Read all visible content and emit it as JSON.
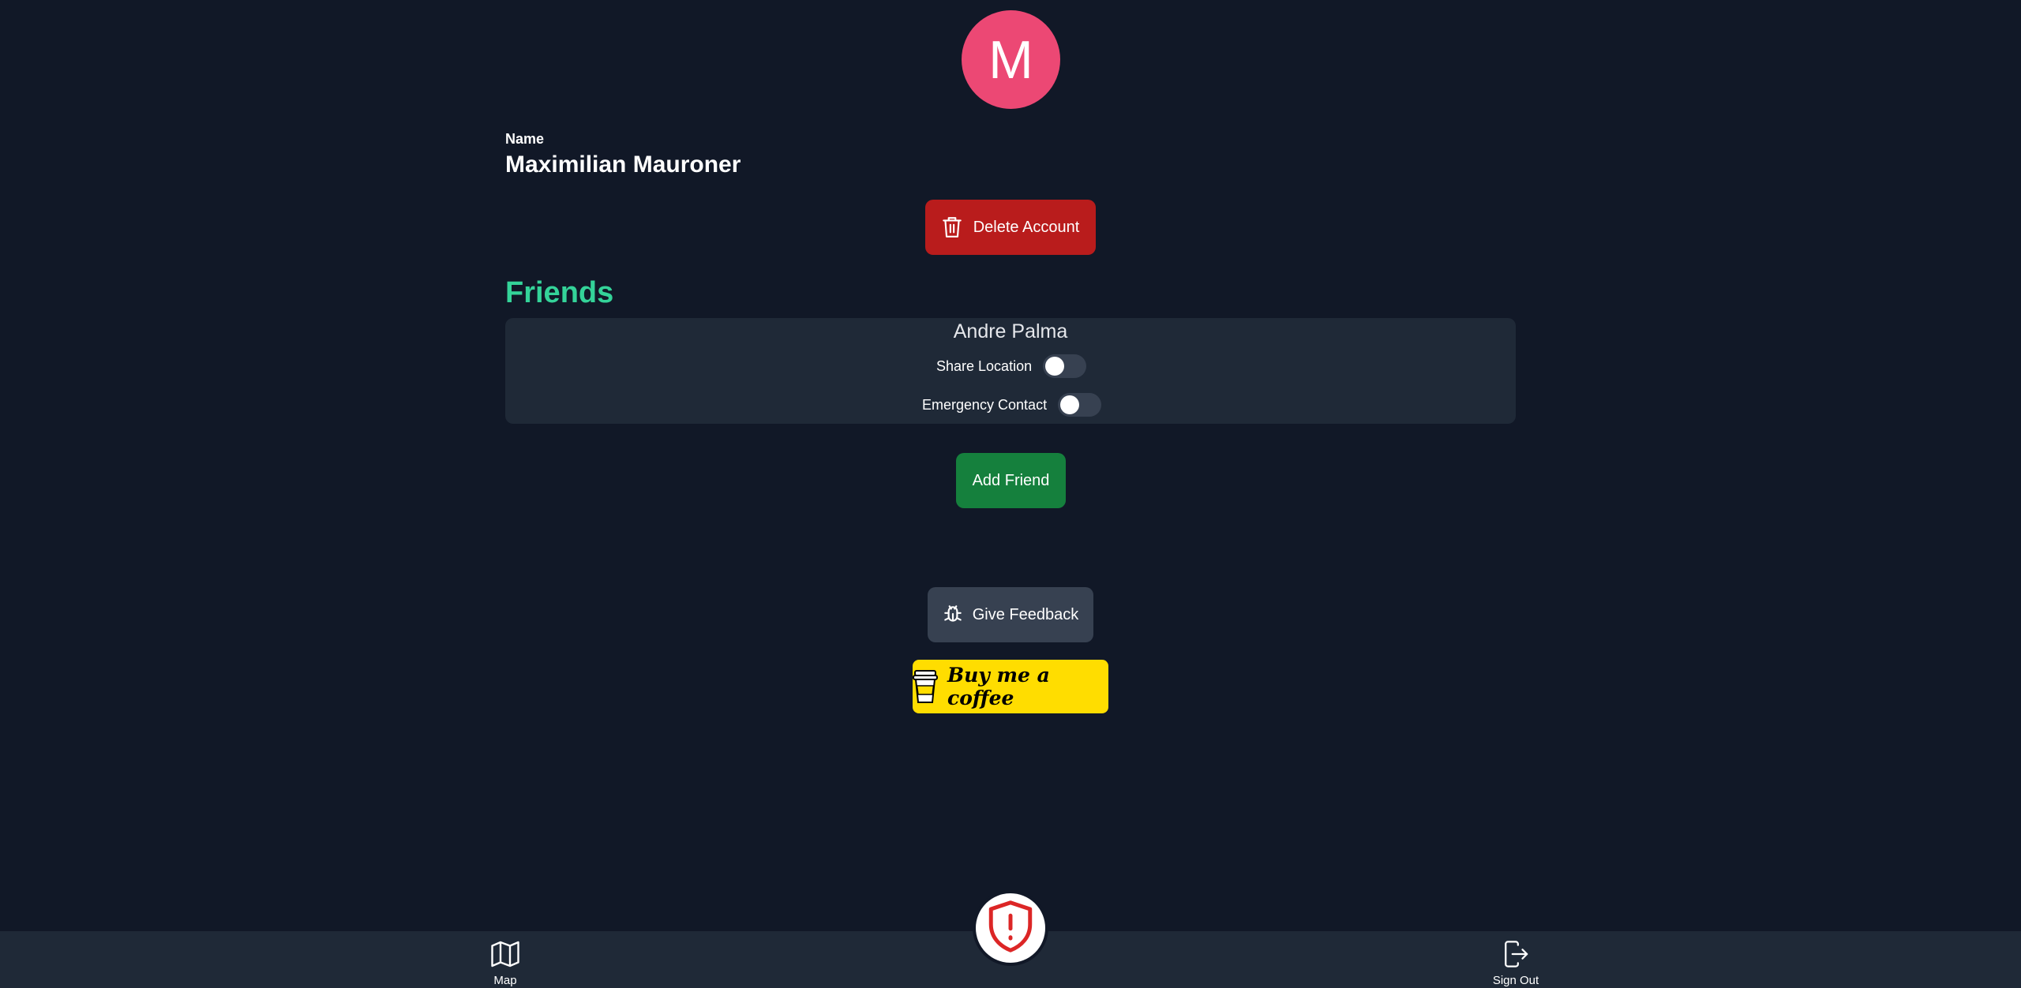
{
  "profile": {
    "avatar_initial": "M",
    "avatar_color": "#ec4874",
    "name_label": "Name",
    "name_value": "Maximilian Mauroner"
  },
  "actions": {
    "delete_account_label": "Delete Account",
    "add_friend_label": "Add Friend",
    "give_feedback_label": "Give Feedback",
    "buy_coffee_label": "Buy me a coffee"
  },
  "friends": {
    "heading": "Friends",
    "items": [
      {
        "name": "Andre Palma",
        "share_location_label": "Share Location",
        "share_location_on": false,
        "emergency_contact_label": "Emergency Contact",
        "emergency_contact_on": false
      }
    ]
  },
  "nav": {
    "map_label": "Map",
    "map_icon": "map-icon",
    "signout_label": "Sign Out",
    "signout_icon": "sign-out-icon",
    "sos_icon": "shield-alert-icon"
  },
  "colors": {
    "background": "#111827",
    "card": "#1f2937",
    "accent_green": "#34d399",
    "delete_red": "#b91c1c",
    "add_green": "#15803d",
    "coffee_yellow": "#ffdd00"
  }
}
